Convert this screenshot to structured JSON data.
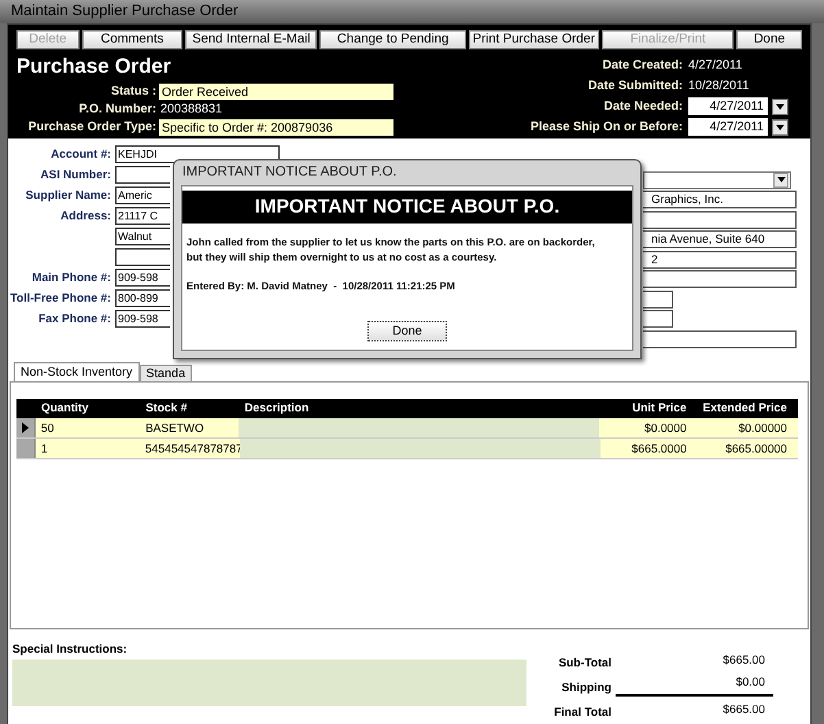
{
  "window": {
    "title": "Maintain Supplier Purchase Order"
  },
  "toolbar": [
    {
      "label": "Delete",
      "disabled": true
    },
    {
      "label": "Comments",
      "disabled": false
    },
    {
      "label": "Send Internal E-Mail",
      "disabled": false
    },
    {
      "label": "Change to Pending",
      "disabled": false
    },
    {
      "label": "Print Purchase Order",
      "disabled": false
    },
    {
      "label": "Finalize/Print",
      "disabled": true
    },
    {
      "label": "Done",
      "disabled": false
    }
  ],
  "header": {
    "title": "Purchase Order",
    "left": [
      {
        "label": "Status :",
        "value": "Order Received",
        "kind": "field"
      },
      {
        "label": "P.O. Number:",
        "value": "200388831",
        "kind": "text"
      },
      {
        "label": "Purchase Order Type:",
        "value": "Specific to Order #: 200879036",
        "kind": "field"
      }
    ],
    "right": [
      {
        "label": "Date Created:",
        "value": "4/27/2011",
        "kind": "text"
      },
      {
        "label": "Date Submitted:",
        "value": "10/28/2011",
        "kind": "text"
      },
      {
        "label": "Date Needed:",
        "value": "4/27/2011",
        "kind": "date"
      },
      {
        "label": "Please Ship On or Before:",
        "value": "4/27/2011",
        "kind": "date"
      }
    ]
  },
  "supplier_left": [
    {
      "label": "Account #:",
      "value": "KEHJDI",
      "kind": "wide"
    },
    {
      "label": "ASI Number:",
      "kind": "stub"
    },
    {
      "label": "Supplier Name:",
      "value": "Americ",
      "kind": "stub"
    },
    {
      "label": "Address:",
      "value": "21117 C",
      "kind": "stub"
    },
    {
      "value": "Walnut",
      "kind": "stub"
    },
    {
      "kind": "stub"
    },
    {
      "label": "Main Phone #:",
      "value": "909-598",
      "kind": "stub"
    },
    {
      "label": "Toll-Free Phone #:",
      "value": "800-899",
      "kind": "stub"
    },
    {
      "label": "Fax Phone #:",
      "value": "909-598",
      "kind": "stub"
    }
  ],
  "supplier_right": [
    {
      "kind": "dropdown"
    },
    {
      "value": "Graphics, Inc.",
      "kind": "wide"
    },
    {
      "kind": "wide"
    },
    {
      "value": "nia Avenue, Suite 640",
      "kind": "wide"
    },
    {
      "value": "2",
      "kind": "wide"
    },
    {
      "kind": "wide"
    },
    {
      "kind": "short"
    },
    {
      "kind": "short"
    },
    {
      "kind": "wide"
    }
  ],
  "dialog": {
    "title": "IMPORTANT NOTICE ABOUT P.O.",
    "heading": "IMPORTANT NOTICE ABOUT P.O.",
    "message": [
      "John called from the supplier to let us know the parts on this P.O. are on backorder,",
      "but they will ship them overnight to us at no cost as a courtesy."
    ],
    "entered_by": "Entered By: M. David Matney  -  10/28/2011 11:21:25 PM",
    "button": "Done"
  },
  "tabs": [
    {
      "label": "Non-Stock Inventory",
      "selected": true
    },
    {
      "label": "Standa",
      "selected": false
    }
  ],
  "table": {
    "columns": [
      "Quantity",
      "Stock #",
      "Description",
      "Unit Price",
      "Extended Price"
    ],
    "rows": [
      {
        "selected": true,
        "cells": [
          "50",
          "BASETWO",
          "",
          "$0.0000",
          "$0.00000"
        ]
      },
      {
        "selected": false,
        "cells": [
          "1",
          "545454547878787",
          "",
          "$665.0000",
          "$665.00000"
        ]
      }
    ]
  },
  "special_instructions": {
    "label": "Special Instructions:"
  },
  "totals": [
    {
      "label": "Sub-Total",
      "value": "$665.00"
    },
    {
      "label": "Shipping",
      "value": "$0.00"
    },
    {
      "label": "Final Total",
      "value": "$665.00"
    }
  ]
}
